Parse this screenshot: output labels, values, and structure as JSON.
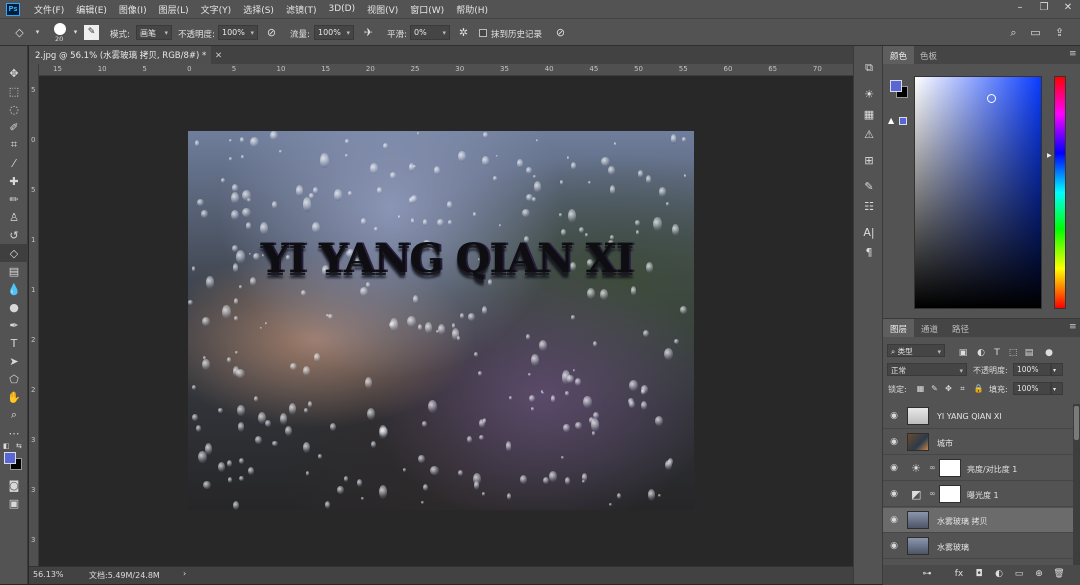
{
  "menubar": {
    "logo": "Ps",
    "items": [
      "文件(F)",
      "编辑(E)",
      "图像(I)",
      "图层(L)",
      "文字(Y)",
      "选择(S)",
      "滤镜(T)",
      "3D(D)",
      "视图(V)",
      "窗口(W)",
      "帮助(H)"
    ]
  },
  "optbar": {
    "brush_size": "20",
    "mode_label": "模式:",
    "mode_value": "画笔",
    "opacity_label": "不透明度:",
    "opacity_value": "100%",
    "flow_label": "流量:",
    "flow_value": "100%",
    "smooth_label": "平滑:",
    "smooth_value": "0%",
    "erase_history_label": "抹到历史记录"
  },
  "document": {
    "tab_title": "2.jpg @ 56.1% (水雾玻璃 拷贝, RGB/8#) *",
    "art_text": "YI YANG QIAN XI",
    "zoom": "56.13%",
    "doc_info": "文档:5.49M/24.8M"
  },
  "ruler": {
    "top_ticks": [
      "15",
      "10",
      "5",
      "0",
      "5",
      "10",
      "15",
      "20",
      "25",
      "30",
      "35",
      "40",
      "45",
      "50",
      "55",
      "60",
      "65",
      "70"
    ],
    "left_ticks": [
      "5",
      "0",
      "5",
      "1",
      "1",
      "2",
      "2",
      "3",
      "3",
      "3"
    ]
  },
  "colorpanel": {
    "tabs": [
      "颜色",
      "色板"
    ],
    "foreground_color": "#5866d8",
    "background_color": "#000000"
  },
  "layerspanel": {
    "tabs": [
      "图层",
      "通道",
      "路径"
    ],
    "filter_label": "类型",
    "blend_mode": "正常",
    "opacity_label": "不透明度:",
    "opacity_value": "100%",
    "lock_label": "锁定:",
    "fill_label": "填充:",
    "fill_value": "100%",
    "layers": [
      {
        "name": "YI YANG QIAN XI",
        "selected": false,
        "kind": "text"
      },
      {
        "name": "城市",
        "selected": false,
        "kind": "image"
      },
      {
        "name": "亮度/对比度 1",
        "selected": false,
        "kind": "adjust"
      },
      {
        "name": "曝光度 1",
        "selected": false,
        "kind": "adjust"
      },
      {
        "name": "水雾玻璃 拷贝",
        "selected": true,
        "kind": "glass"
      },
      {
        "name": "水雾玻璃",
        "selected": false,
        "kind": "glass"
      }
    ]
  }
}
